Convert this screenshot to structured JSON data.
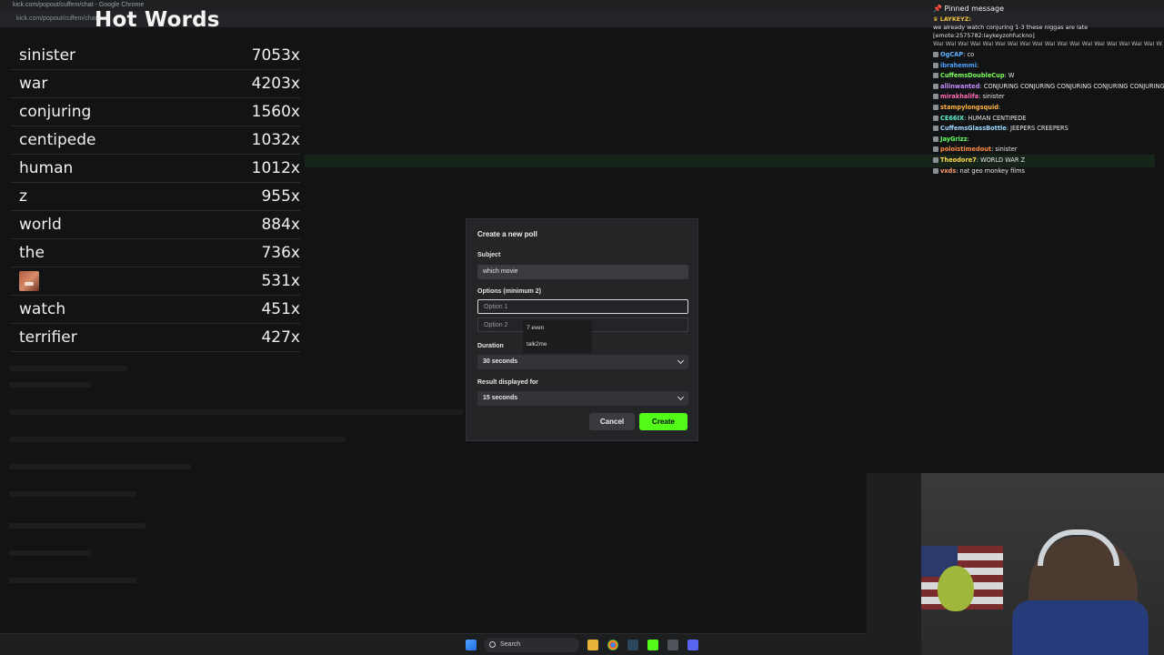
{
  "browser": {
    "window_title": "kick.com/popout/cuffem/chat - Google Chrome",
    "address": "kick.com/popout/cuffem/chat"
  },
  "hot_words": {
    "title": "Hot Words",
    "items": [
      {
        "word": "sinister",
        "count": "7053x"
      },
      {
        "word": "war",
        "count": "4203x"
      },
      {
        "word": "conjuring",
        "count": "1560x"
      },
      {
        "word": "centipede",
        "count": "1032x"
      },
      {
        "word": "human",
        "count": "1012x"
      },
      {
        "word": "z",
        "count": "955x"
      },
      {
        "word": "world",
        "count": "884x"
      },
      {
        "word": "the",
        "count": "736x"
      },
      {
        "word": "",
        "count": "531x",
        "emote": true
      },
      {
        "word": "watch",
        "count": "451x"
      },
      {
        "word": "terrifier",
        "count": "427x"
      }
    ]
  },
  "chat": {
    "pinned_label": "Pinned message",
    "pinned_user": "LAYKEYZ:",
    "pinned_text": "we already watch conjuring 1-3 these niggas are late",
    "pinned_emote": "[emote:2575782:laykeyzohfuckno]",
    "pinned_spam": "Wal Wal Wal Wal Wal Wal Wal Wal Wal Wal Wal Wal Wal Wal Wal Wal Wal Wal Wal Wal Wal Wal Wal",
    "messages": [
      {
        "user": "OgCAP",
        "text": "co",
        "color": "#5fb3ff"
      },
      {
        "user": "ibrahemmi",
        "text": "",
        "color": "#4da3ff"
      },
      {
        "user": "CuffemsDoubleCup",
        "text": "W",
        "color": "#7cff5e"
      },
      {
        "user": "allinwanted",
        "text": "CONJURING CONJURING CONJURING CONJURING CONJURING CON",
        "color": "#c98bff"
      },
      {
        "user": "mirakhalifa",
        "text": "sinister",
        "color": "#ff6bb5"
      },
      {
        "user": "stampylongsquid",
        "text": "",
        "color": "#ffb347"
      },
      {
        "user": "CE66IX",
        "text": "HUMAN CENTIPEDE",
        "color": "#5ff0d0"
      },
      {
        "user": "CuffemsGlassBottle",
        "text": "JEEPERS CREEPERS",
        "color": "#9fd8ff"
      },
      {
        "user": "JayGrizz",
        "text": "",
        "color": "#66ff66"
      },
      {
        "user": "poloistimedout",
        "text": "sinister",
        "color": "#ff8c42"
      },
      {
        "user": "Theodore7",
        "text": "WORLD WAR Z",
        "color": "#ffd84d"
      },
      {
        "user": "vxds",
        "text": "nat geo monkey films",
        "color": "#ff9f6b"
      }
    ]
  },
  "poll_modal": {
    "title": "Create a new poll",
    "subject_label": "Subject",
    "subject_value": "which movie",
    "options_label": "Options (minimum 2)",
    "option1_placeholder": "Option 1",
    "option2_placeholder": "Option 2",
    "autocomplete": [
      "7 even",
      "talk2me"
    ],
    "duration_label": "Duration",
    "duration_value": "30 seconds",
    "result_label": "Result displayed for",
    "result_value": "15 seconds",
    "cancel_label": "Cancel",
    "create_label": "Create"
  },
  "taskbar": {
    "search_label": "Search"
  },
  "colors": {
    "accent": "#53fc18"
  }
}
